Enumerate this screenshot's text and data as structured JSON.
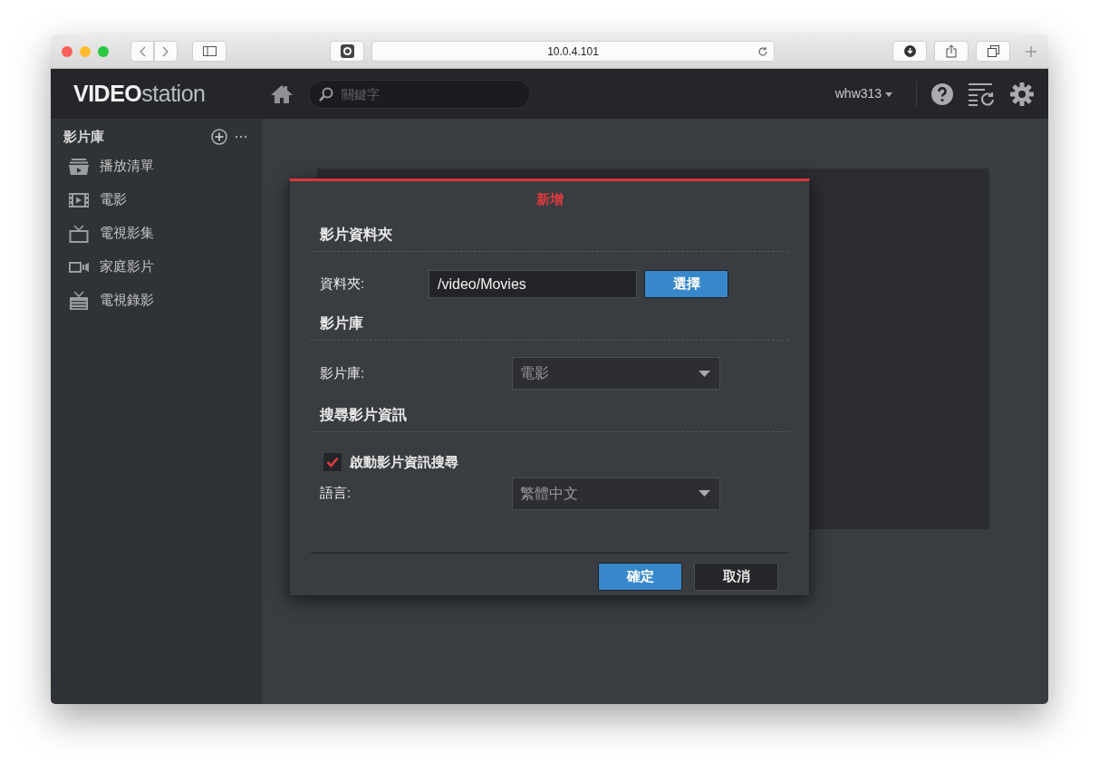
{
  "browser": {
    "url": "10.0.4.101"
  },
  "header": {
    "logo": "**VIDEO**station",
    "search": {
      "placeholder": "關鍵字"
    },
    "user": "whw313"
  },
  "sidebar": {
    "title": "影片庫",
    "items": [
      {
        "label": "播放清單"
      },
      {
        "label": "電影"
      },
      {
        "label": "電視影集"
      },
      {
        "label": "家庭影片"
      },
      {
        "label": "電視錄影"
      }
    ]
  },
  "dialog": {
    "title": "新增",
    "sections": [
      {
        "heading": "影片資料夾",
        "rows": [
          {
            "kind": "text-input",
            "label": "資料夾:",
            "value": "/video/Movies",
            "button": "選擇"
          }
        ]
      },
      {
        "heading": "影片庫",
        "rows": [
          {
            "kind": "select",
            "label": "影片庫:",
            "value": "電影"
          }
        ]
      },
      {
        "heading": "搜尋影片資訊",
        "rows": [
          {
            "kind": "checkbox",
            "label": "啟動影片資訊搜尋",
            "checked": true
          },
          {
            "kind": "select",
            "label": "語言:",
            "value": "繁體中文"
          }
        ]
      }
    ],
    "buttons": [
      {
        "label": "確定",
        "kind": "primary"
      },
      {
        "label": "取消",
        "kind": "secondary"
      }
    ]
  }
}
